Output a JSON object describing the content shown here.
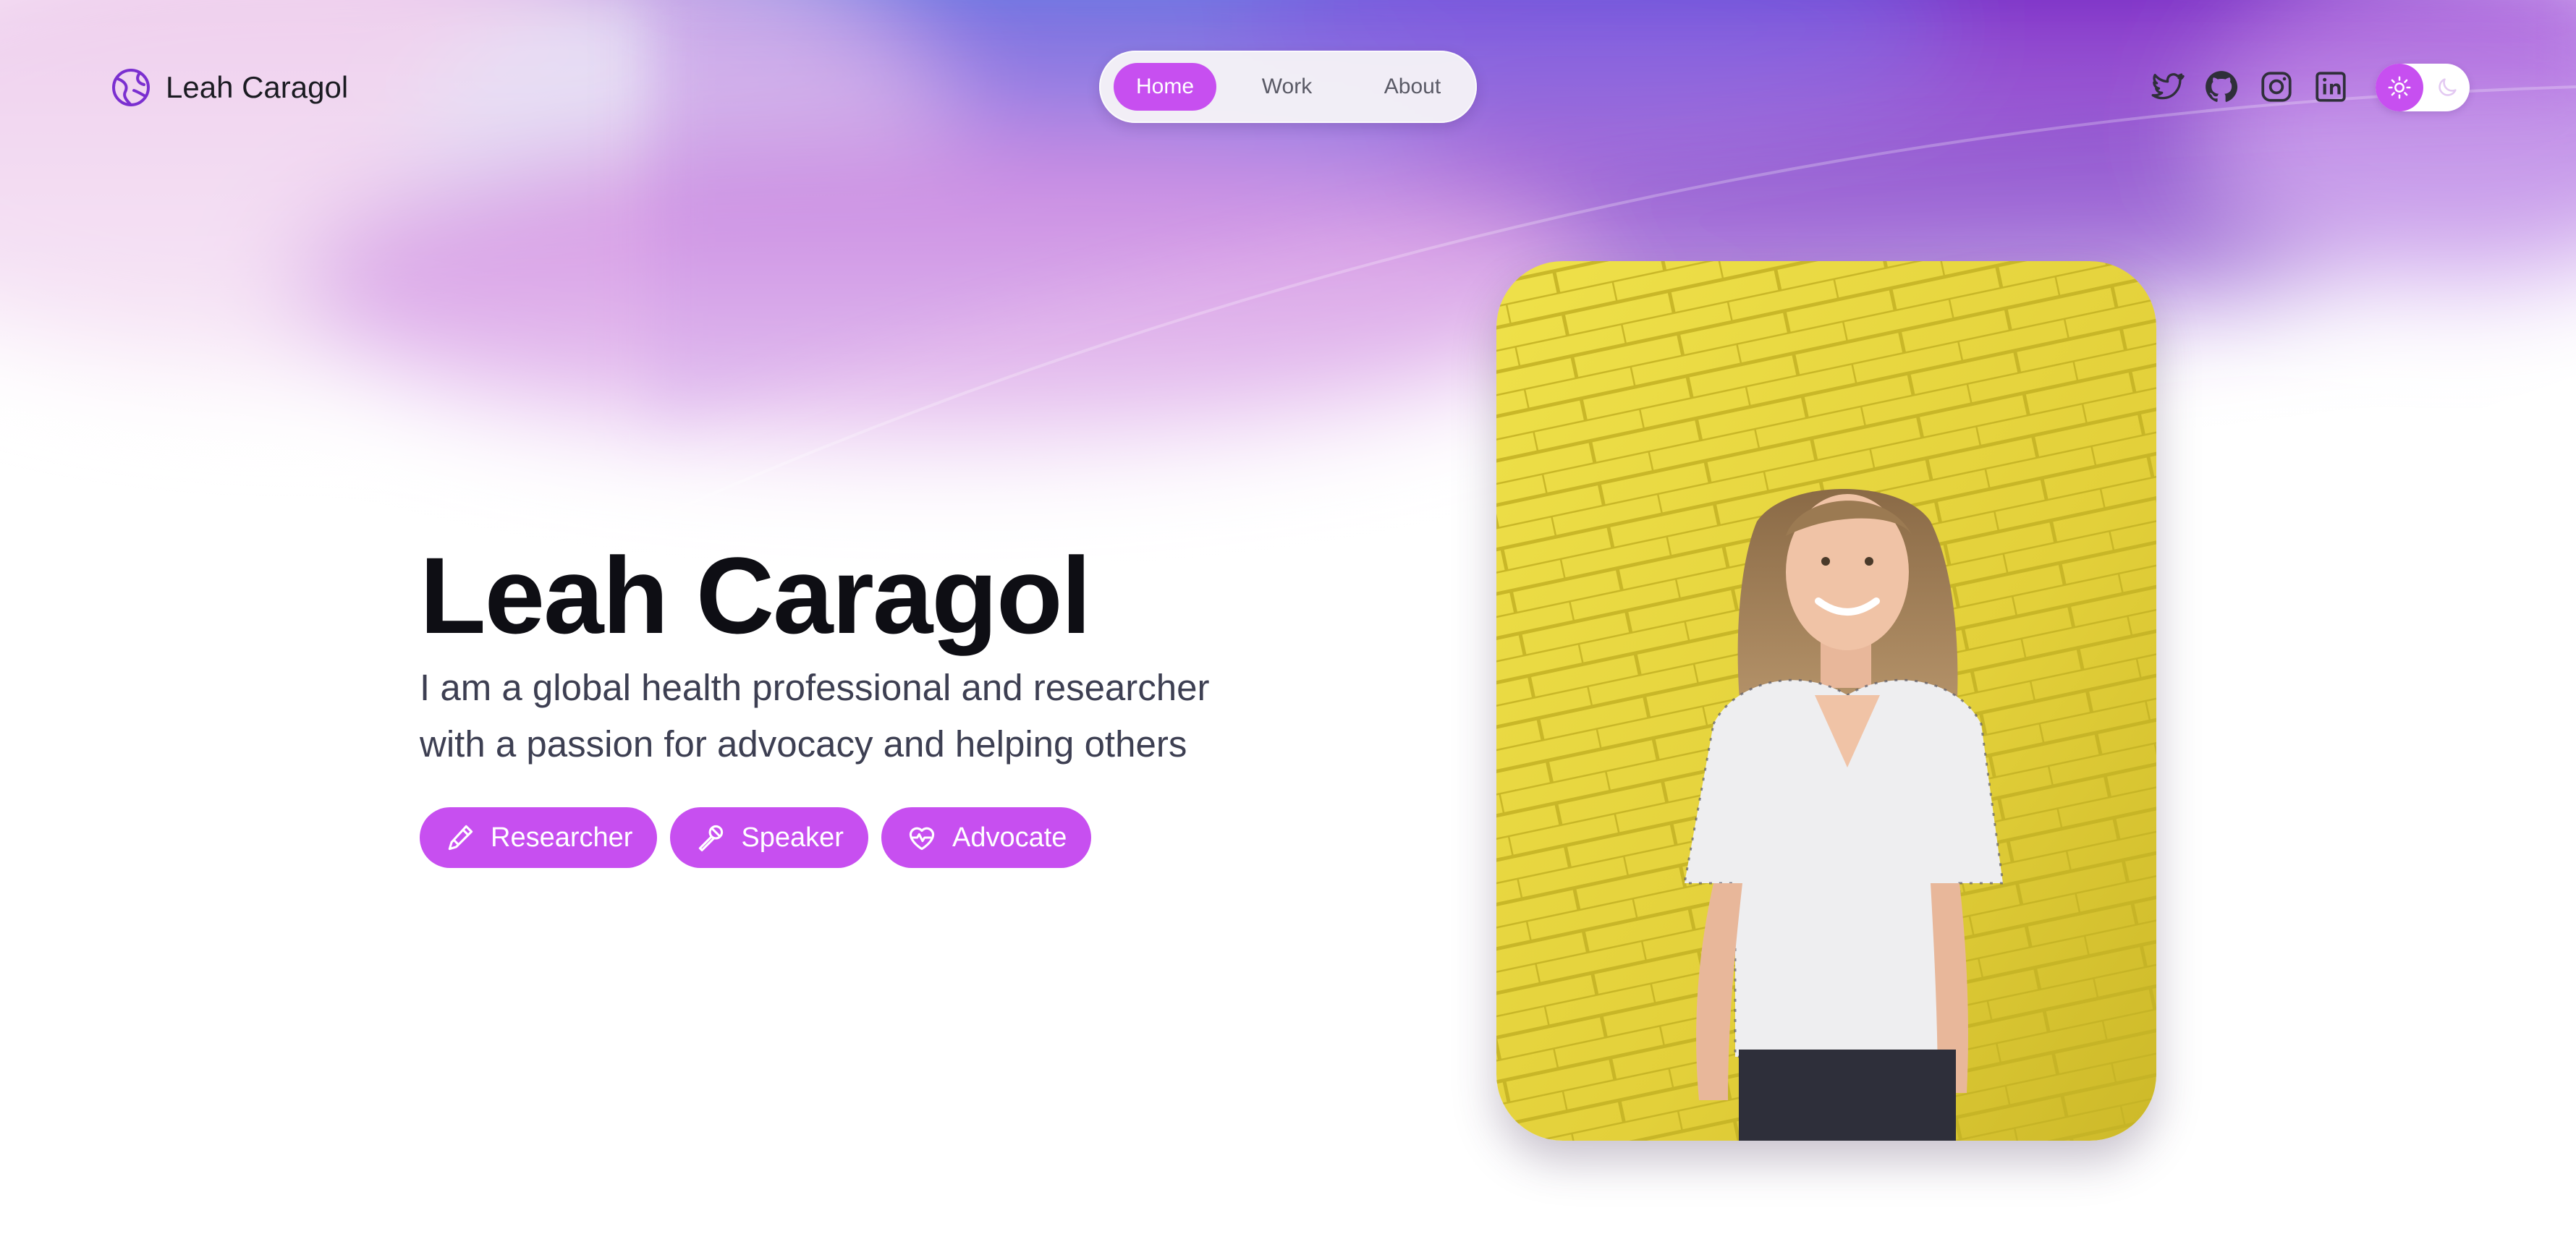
{
  "header": {
    "logo_icon": "globe-icon",
    "site_name": "Leah Caragol"
  },
  "nav": {
    "items": [
      {
        "label": "Home",
        "active": true
      },
      {
        "label": "Work",
        "active": false
      },
      {
        "label": "About",
        "active": false
      }
    ]
  },
  "social": [
    {
      "icon": "twitter-icon"
    },
    {
      "icon": "github-icon"
    },
    {
      "icon": "instagram-icon"
    },
    {
      "icon": "linkedin-icon"
    }
  ],
  "theme_toggle": {
    "mode": "light",
    "light_icon": "sun-icon",
    "dark_icon": "moon-icon"
  },
  "hero": {
    "title": "Leah Caragol",
    "subtitle_line1": "I am a global health professional and researcher",
    "subtitle_line2": "with a passion for advocacy and helping others",
    "tags": [
      {
        "label": "Researcher",
        "icon": "pencil-icon"
      },
      {
        "label": "Speaker",
        "icon": "microphone-icon"
      },
      {
        "label": "Advocate",
        "icon": "heart-pulse-icon"
      }
    ]
  },
  "photo": {
    "subject": "portrait-photo"
  },
  "colors": {
    "accent": "#c74ff0",
    "accent_dark": "#7b2fd0",
    "text_dark": "#0e0e14",
    "text_muted": "#3d3f52",
    "photo_wall": "#e6d23a"
  }
}
